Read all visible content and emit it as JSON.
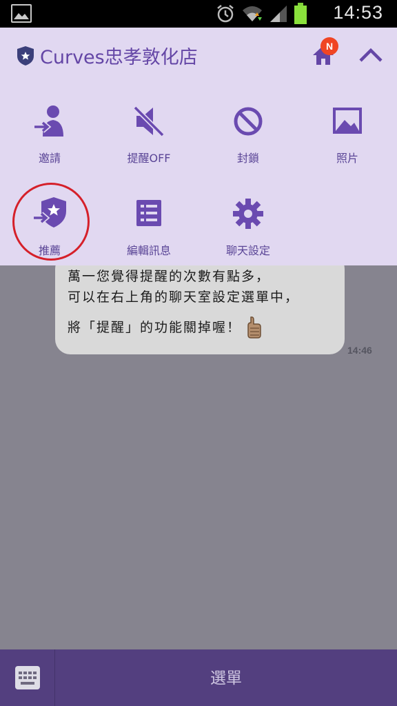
{
  "status_bar": {
    "time": "14:53",
    "icons": [
      "gallery-icon",
      "alarm-icon",
      "wifi-icon",
      "signal-icon",
      "battery-icon"
    ]
  },
  "header": {
    "title": "Curves忠孝敦化店",
    "notification_badge": "N"
  },
  "menu": {
    "items": [
      {
        "label": "邀請",
        "icon": "invite-person-icon"
      },
      {
        "label": "提醒OFF",
        "icon": "speaker-muted-icon"
      },
      {
        "label": "封鎖",
        "icon": "block-icon"
      },
      {
        "label": "照片",
        "icon": "photo-icon"
      },
      {
        "label": "推薦",
        "icon": "recommend-shield-icon"
      },
      {
        "label": "編輯訊息",
        "icon": "list-icon"
      },
      {
        "label": "聊天設定",
        "icon": "gear-icon"
      }
    ]
  },
  "chat": {
    "message": {
      "line1": "萬一您覺得提醒的次數有點多，",
      "line2": "可以在右上角的聊天室設定選單中，",
      "line3": "將「提醒」的功能關掉喔！",
      "time": "14:46"
    }
  },
  "bottom_bar": {
    "menu_label": "選單"
  },
  "colors": {
    "panel_bg": "#e1d8f1",
    "accent_purple": "#6446a6",
    "bottom_bar": "#533f7f",
    "badge_red": "#f04524",
    "highlight_red": "#d5202a",
    "chat_bg": "#86848f"
  }
}
